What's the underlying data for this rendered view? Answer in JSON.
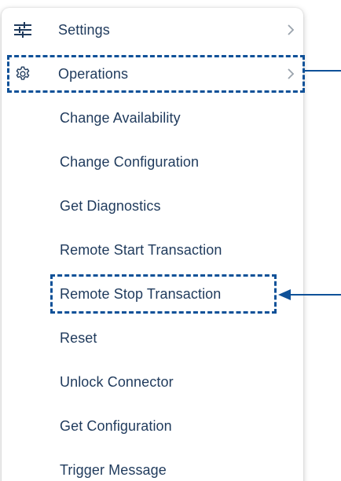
{
  "menu": {
    "settings": {
      "label": "Settings",
      "icon": "sliders-icon"
    },
    "operations": {
      "label": "Operations",
      "icon": "gear-icon"
    },
    "items": [
      {
        "label": "Change Availability"
      },
      {
        "label": "Change Configuration"
      },
      {
        "label": "Get Diagnostics"
      },
      {
        "label": "Remote Start Transaction"
      },
      {
        "label": "Remote Stop Transaction"
      },
      {
        "label": "Reset"
      },
      {
        "label": "Unlock Connector"
      },
      {
        "label": "Get Configuration"
      },
      {
        "label": "Trigger Message"
      }
    ]
  },
  "annotations": {
    "color": "#0f5198",
    "highlighted": [
      "Operations",
      "Remote Stop Transaction"
    ]
  },
  "colors": {
    "text": "#1f3a5c",
    "icon": "#1f3a5c",
    "chevron": "#9aa3ad"
  }
}
